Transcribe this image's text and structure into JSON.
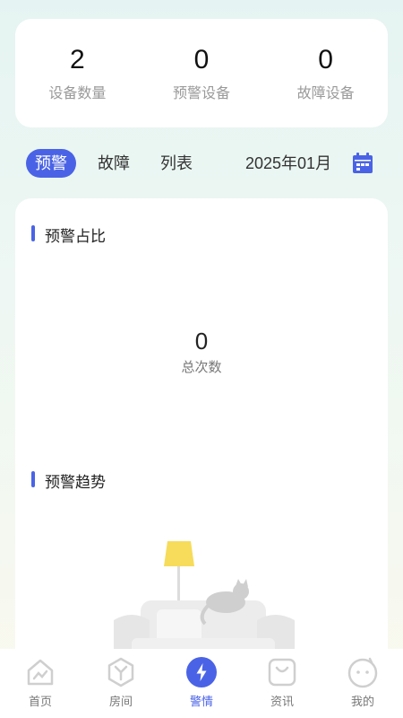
{
  "stats": [
    {
      "value": "2",
      "label": "设备数量"
    },
    {
      "value": "0",
      "label": "预警设备"
    },
    {
      "value": "0",
      "label": "故障设备"
    }
  ],
  "tabs": [
    {
      "label": "预警",
      "active": true
    },
    {
      "label": "故障",
      "active": false
    },
    {
      "label": "列表",
      "active": false
    }
  ],
  "date": "2025年01月",
  "sections": {
    "ratio_title": "预警占比",
    "total_value": "0",
    "total_label": "总次数",
    "trend_title": "预警趋势"
  },
  "nav": [
    {
      "label": "首页",
      "icon": "home-icon"
    },
    {
      "label": "房间",
      "icon": "room-icon"
    },
    {
      "label": "警情",
      "icon": "alert-icon",
      "active": true
    },
    {
      "label": "资讯",
      "icon": "news-icon"
    },
    {
      "label": "我的",
      "icon": "profile-icon"
    }
  ],
  "colors": {
    "accent": "#4a63e6",
    "lamp": "#f6dc5a"
  }
}
